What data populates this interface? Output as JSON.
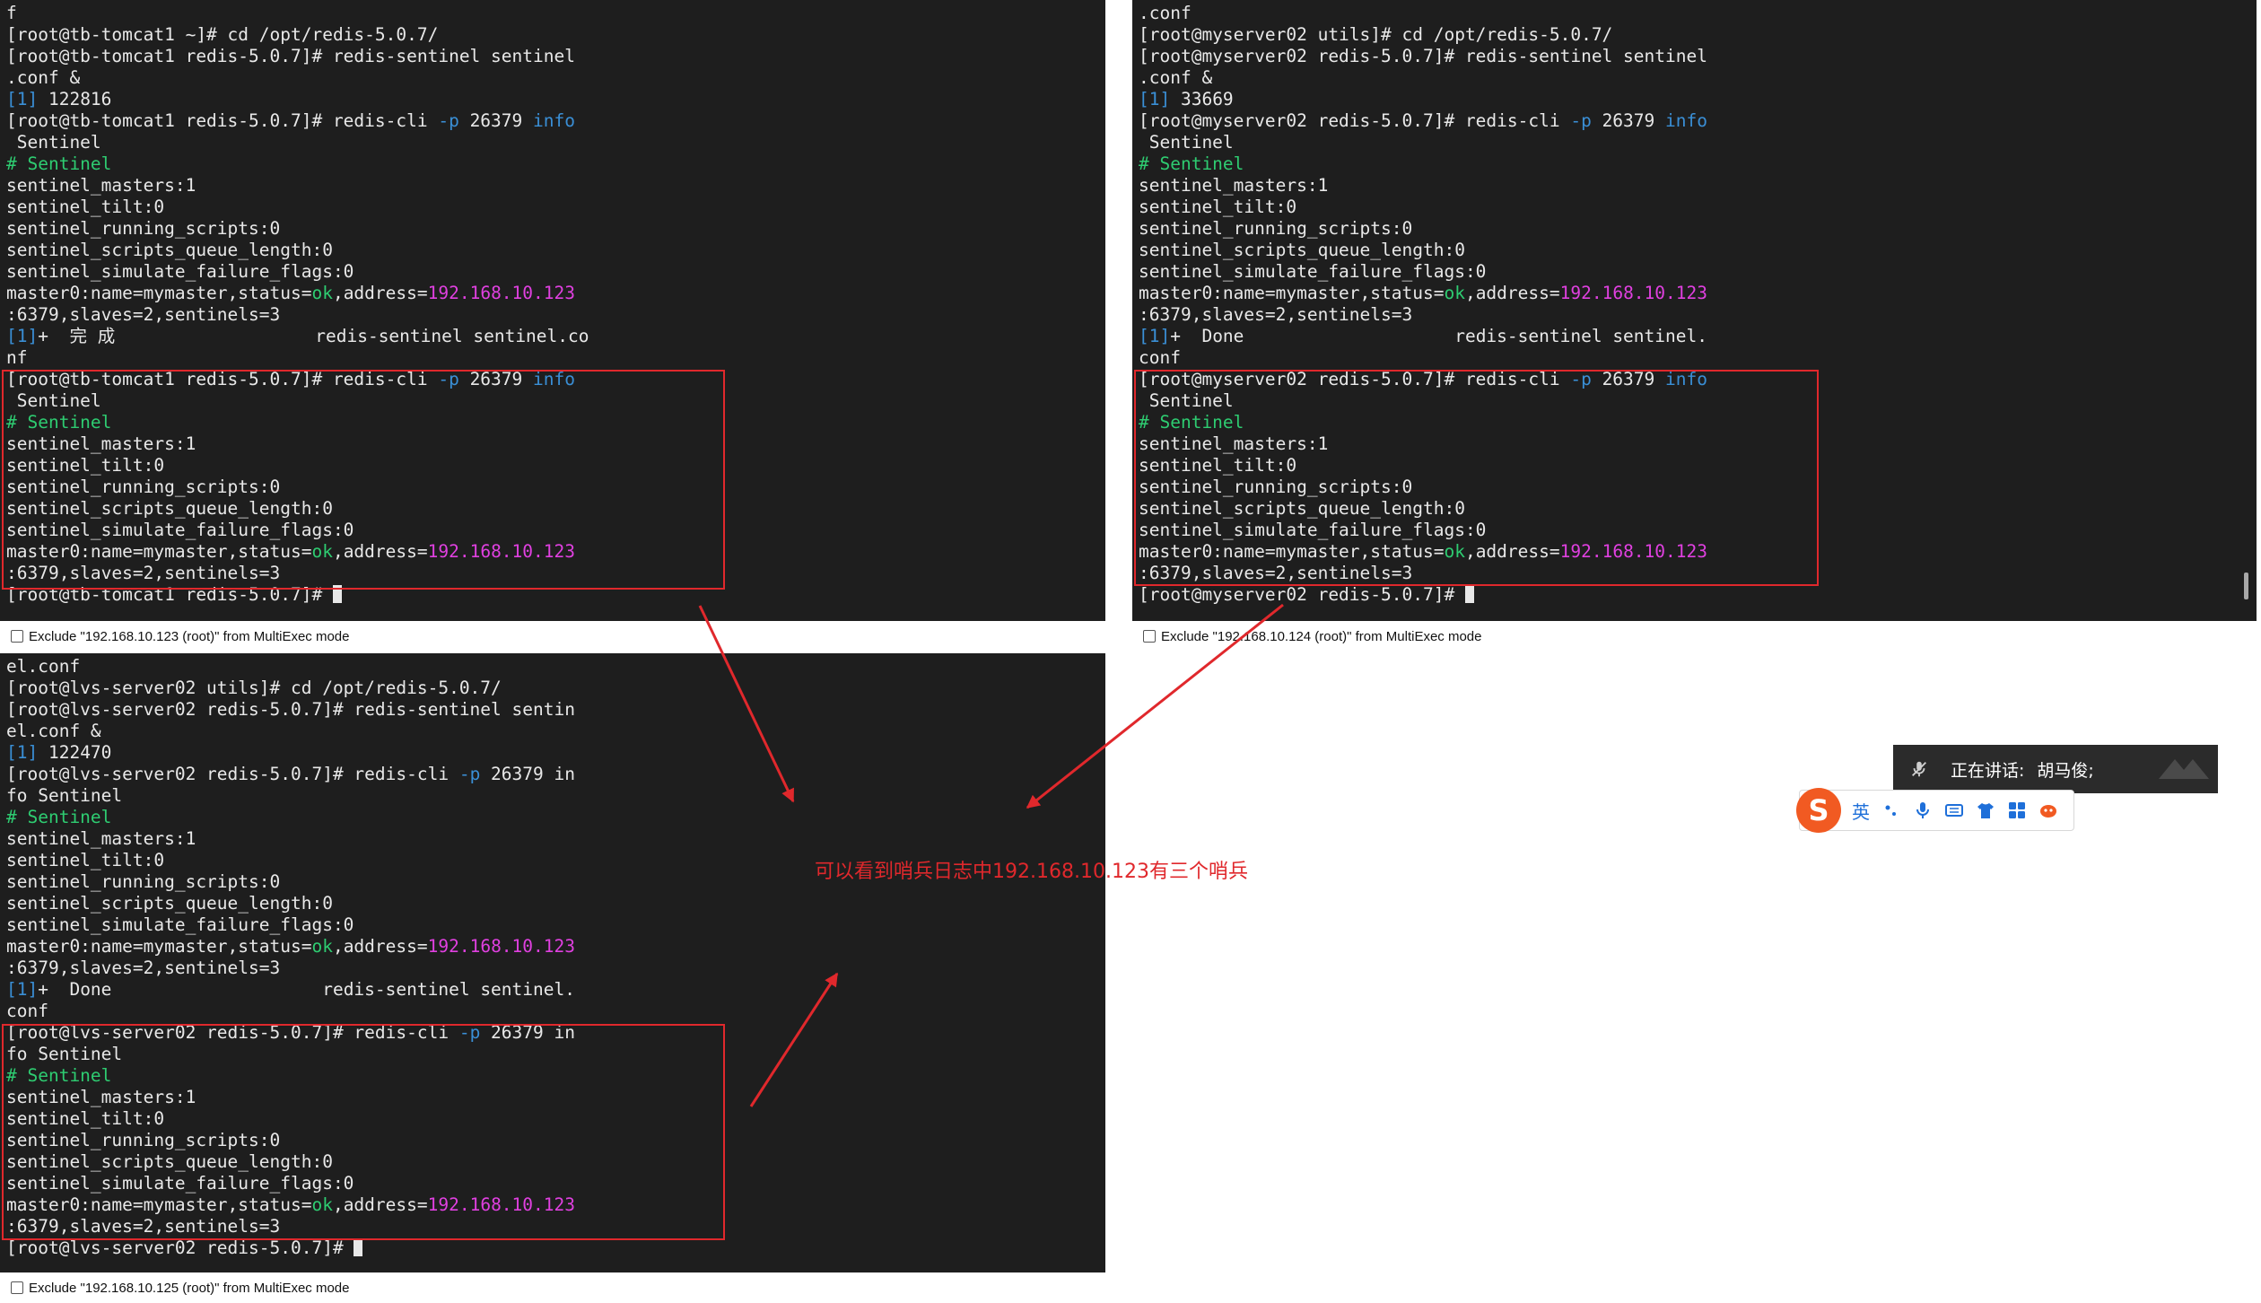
{
  "panes": [
    {
      "host_label": "Exclude \"192.168.10.123 (root)\" from MultiExec mode",
      "lines": [
        [
          {
            "t": "f"
          }
        ],
        [
          {
            "t": "[root@tb-tomcat1 ~]# cd /opt/redis-5.0.7/"
          }
        ],
        [
          {
            "t": "[root@tb-tomcat1 redis-5.0.7]# redis-sentinel sentinel"
          }
        ],
        [
          {
            "t": ".conf &"
          }
        ],
        [
          {
            "t": "[1]",
            "c": "blue"
          },
          {
            "t": " 122816"
          }
        ],
        [
          {
            "t": "[root@tb-tomcat1 redis-5.0.7]# redis-cli "
          },
          {
            "t": "-p",
            "c": "blue"
          },
          {
            "t": " 26379 "
          },
          {
            "t": "info",
            "c": "blue"
          }
        ],
        [
          {
            "t": " Sentinel"
          }
        ],
        [
          {
            "t": "# Sentinel",
            "c": "green"
          }
        ],
        [
          {
            "t": "sentinel_masters:1"
          }
        ],
        [
          {
            "t": "sentinel_tilt:0"
          }
        ],
        [
          {
            "t": "sentinel_running_scripts:0"
          }
        ],
        [
          {
            "t": "sentinel_scripts_queue_length:0"
          }
        ],
        [
          {
            "t": "sentinel_simulate_failure_flags:0"
          }
        ],
        [
          {
            "t": "master0:name=mymaster,status="
          },
          {
            "t": "ok",
            "c": "green"
          },
          {
            "t": ",address="
          },
          {
            "t": "192.168.10.123",
            "c": "magenta"
          }
        ],
        [
          {
            "t": ":6379,slaves=2,sentinels=3"
          }
        ],
        [
          {
            "t": "[1]",
            "c": "blue"
          },
          {
            "t": "+  完 成                   redis-sentinel sentinel.co"
          }
        ],
        [
          {
            "t": "nf"
          }
        ],
        [
          {
            "t": "[root@tb-tomcat1 redis-5.0.7]# redis-cli "
          },
          {
            "t": "-p",
            "c": "blue"
          },
          {
            "t": " 26379 "
          },
          {
            "t": "info",
            "c": "blue"
          }
        ],
        [
          {
            "t": " Sentinel"
          }
        ],
        [
          {
            "t": "# Sentinel",
            "c": "green"
          }
        ],
        [
          {
            "t": "sentinel_masters:1"
          }
        ],
        [
          {
            "t": "sentinel_tilt:0"
          }
        ],
        [
          {
            "t": "sentinel_running_scripts:0"
          }
        ],
        [
          {
            "t": "sentinel_scripts_queue_length:0"
          }
        ],
        [
          {
            "t": "sentinel_simulate_failure_flags:0"
          }
        ],
        [
          {
            "t": "master0:name=mymaster,status="
          },
          {
            "t": "ok",
            "c": "green"
          },
          {
            "t": ",address="
          },
          {
            "t": "192.168.10.123",
            "c": "magenta"
          }
        ],
        [
          {
            "t": ":6379,slaves=2,sentinels=3"
          }
        ],
        [
          {
            "t": "[root@tb-tomcat1 redis-5.0.7]# "
          },
          {
            "cursor": true
          }
        ]
      ]
    },
    {
      "host_label": "Exclude \"192.168.10.124 (root)\" from MultiExec mode",
      "lines": [
        [
          {
            "t": ".conf"
          }
        ],
        [
          {
            "t": "[root@myserver02 utils]# cd /opt/redis-5.0.7/"
          }
        ],
        [
          {
            "t": "[root@myserver02 redis-5.0.7]# redis-sentinel sentinel"
          }
        ],
        [
          {
            "t": ".conf &"
          }
        ],
        [
          {
            "t": "[1]",
            "c": "blue"
          },
          {
            "t": " 33669"
          }
        ],
        [
          {
            "t": "[root@myserver02 redis-5.0.7]# redis-cli "
          },
          {
            "t": "-p",
            "c": "blue"
          },
          {
            "t": " 26379 "
          },
          {
            "t": "info",
            "c": "blue"
          }
        ],
        [
          {
            "t": " Sentinel"
          }
        ],
        [
          {
            "t": "# Sentinel",
            "c": "green"
          }
        ],
        [
          {
            "t": "sentinel_masters:1"
          }
        ],
        [
          {
            "t": "sentinel_tilt:0"
          }
        ],
        [
          {
            "t": "sentinel_running_scripts:0"
          }
        ],
        [
          {
            "t": "sentinel_scripts_queue_length:0"
          }
        ],
        [
          {
            "t": "sentinel_simulate_failure_flags:0"
          }
        ],
        [
          {
            "t": "master0:name=mymaster,status="
          },
          {
            "t": "ok",
            "c": "green"
          },
          {
            "t": ",address="
          },
          {
            "t": "192.168.10.123",
            "c": "magenta"
          }
        ],
        [
          {
            "t": ":6379,slaves=2,sentinels=3"
          }
        ],
        [
          {
            "t": "[1]",
            "c": "blue"
          },
          {
            "t": "+  Done                    redis-sentinel sentinel."
          }
        ],
        [
          {
            "t": "conf"
          }
        ],
        [
          {
            "t": "[root@myserver02 redis-5.0.7]# redis-cli "
          },
          {
            "t": "-p",
            "c": "blue"
          },
          {
            "t": " 26379 "
          },
          {
            "t": "info",
            "c": "blue"
          }
        ],
        [
          {
            "t": " Sentinel"
          }
        ],
        [
          {
            "t": "# Sentinel",
            "c": "green"
          }
        ],
        [
          {
            "t": "sentinel_masters:1"
          }
        ],
        [
          {
            "t": "sentinel_tilt:0"
          }
        ],
        [
          {
            "t": "sentinel_running_scripts:0"
          }
        ],
        [
          {
            "t": "sentinel_scripts_queue_length:0"
          }
        ],
        [
          {
            "t": "sentinel_simulate_failure_flags:0"
          }
        ],
        [
          {
            "t": "master0:name=mymaster,status="
          },
          {
            "t": "ok",
            "c": "green"
          },
          {
            "t": ",address="
          },
          {
            "t": "192.168.10.123",
            "c": "magenta"
          }
        ],
        [
          {
            "t": ":6379,slaves=2,sentinels=3"
          }
        ],
        [
          {
            "t": "[root@myserver02 redis-5.0.7]# "
          },
          {
            "cursor": true
          }
        ]
      ]
    },
    {
      "host_label": "Exclude \"192.168.10.125 (root)\" from MultiExec mode",
      "lines": [
        [
          {
            "t": "el.conf"
          }
        ],
        [
          {
            "t": "[root@lvs-server02 utils]# cd /opt/redis-5.0.7/"
          }
        ],
        [
          {
            "t": "[root@lvs-server02 redis-5.0.7]# redis-sentinel sentin"
          }
        ],
        [
          {
            "t": "el.conf &"
          }
        ],
        [
          {
            "t": "[1]",
            "c": "blue"
          },
          {
            "t": " 122470"
          }
        ],
        [
          {
            "t": "[root@lvs-server02 redis-5.0.7]# redis-cli "
          },
          {
            "t": "-p",
            "c": "blue"
          },
          {
            "t": " 26379 in"
          }
        ],
        [
          {
            "t": "fo Sentinel"
          }
        ],
        [
          {
            "t": "# Sentinel",
            "c": "green"
          }
        ],
        [
          {
            "t": "sentinel_masters:1"
          }
        ],
        [
          {
            "t": "sentinel_tilt:0"
          }
        ],
        [
          {
            "t": "sentinel_running_scripts:0"
          }
        ],
        [
          {
            "t": "sentinel_scripts_queue_length:0"
          }
        ],
        [
          {
            "t": "sentinel_simulate_failure_flags:0"
          }
        ],
        [
          {
            "t": "master0:name=mymaster,status="
          },
          {
            "t": "ok",
            "c": "green"
          },
          {
            "t": ",address="
          },
          {
            "t": "192.168.10.123",
            "c": "magenta"
          }
        ],
        [
          {
            "t": ":6379,slaves=2,sentinels=3"
          }
        ],
        [
          {
            "t": "[1]",
            "c": "blue"
          },
          {
            "t": "+  Done                    redis-sentinel sentinel."
          }
        ],
        [
          {
            "t": "conf"
          }
        ],
        [
          {
            "t": "[root@lvs-server02 redis-5.0.7]# redis-cli "
          },
          {
            "t": "-p",
            "c": "blue"
          },
          {
            "t": " 26379 in"
          }
        ],
        [
          {
            "t": "fo Sentinel"
          }
        ],
        [
          {
            "t": "# Sentinel",
            "c": "green"
          }
        ],
        [
          {
            "t": "sentinel_masters:1"
          }
        ],
        [
          {
            "t": "sentinel_tilt:0"
          }
        ],
        [
          {
            "t": "sentinel_running_scripts:0"
          }
        ],
        [
          {
            "t": "sentinel_scripts_queue_length:0"
          }
        ],
        [
          {
            "t": "sentinel_simulate_failure_flags:0"
          }
        ],
        [
          {
            "t": "master0:name=mymaster,status="
          },
          {
            "t": "ok",
            "c": "green"
          },
          {
            "t": ",address="
          },
          {
            "t": "192.168.10.123",
            "c": "magenta"
          }
        ],
        [
          {
            "t": ":6379,slaves=2,sentinels=3"
          }
        ],
        [
          {
            "t": "[root@lvs-server02 redis-5.0.7]# "
          },
          {
            "cursor": true
          }
        ]
      ]
    }
  ],
  "annotation": "可以看到哨兵日志中192.168.10.123有三个哨兵",
  "voice_bar": {
    "label": "正在讲话:",
    "speaker": "胡马俊;"
  },
  "ime": {
    "logo": "S",
    "lang": "英"
  },
  "colors": {
    "terminal_bg": "#1e1e1e",
    "terminal_fg": "#e8e8e8",
    "blue": "#3a8fd6",
    "green": "#2ecc71",
    "magenta": "#e040e0",
    "highlight_red": "#e0282c"
  }
}
